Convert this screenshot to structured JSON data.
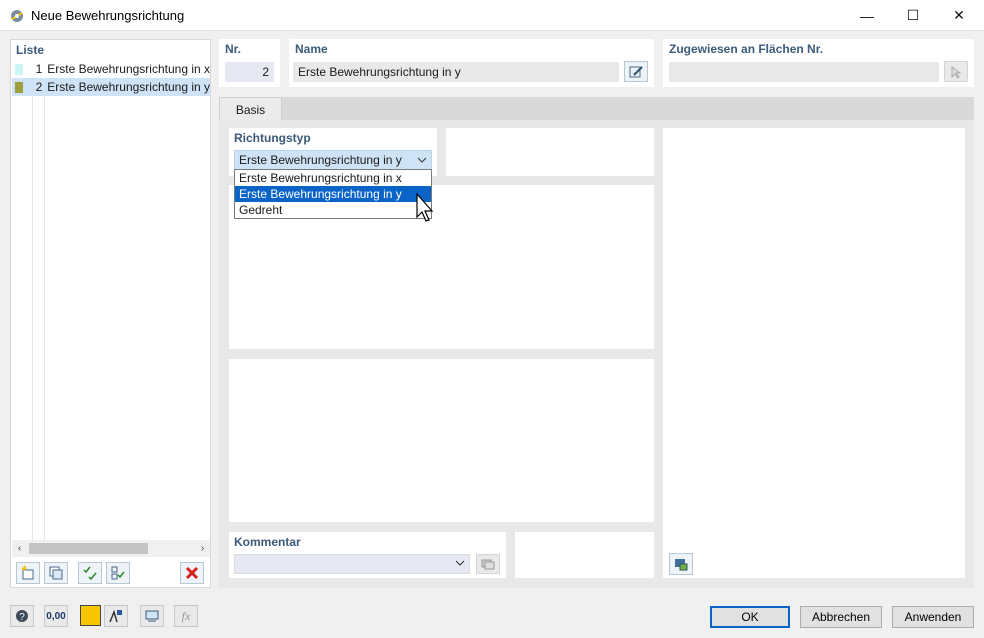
{
  "window": {
    "title": "Neue Bewehrungsrichtung",
    "minimize": "—",
    "maximize": "☐",
    "close": "✕"
  },
  "list": {
    "title": "Liste",
    "items": [
      {
        "num": "1",
        "label": "Erste Bewehrungsrichtung in x",
        "color": "#ccf6f6"
      },
      {
        "num": "2",
        "label": "Erste Bewehrungsrichtung in y",
        "color": "#9e9e3a"
      }
    ],
    "scroll_left": "‹",
    "scroll_right": "›"
  },
  "nr": {
    "label": "Nr.",
    "value": "2"
  },
  "name": {
    "label": "Name",
    "value": "Erste Bewehrungsrichtung in y"
  },
  "assigned": {
    "label": "Zugewiesen an Flächen Nr.",
    "value": ""
  },
  "tabs": [
    {
      "label": "Basis"
    }
  ],
  "richtungstyp": {
    "label": "Richtungstyp",
    "selected": "Erste Bewehrungsrichtung in y",
    "options": [
      "Erste Bewehrungsrichtung in x",
      "Erste Bewehrungsrichtung in y",
      "Gedreht"
    ]
  },
  "kommentar": {
    "label": "Kommentar",
    "value": ""
  },
  "footer": {
    "ok": "OK",
    "cancel": "Abbrechen",
    "apply": "Anwenden",
    "units_icon_text": "0,00"
  },
  "colors": {
    "accent": "#0a64c8",
    "header_text": "#3c5a7a",
    "selection": "#cfe3f6"
  }
}
